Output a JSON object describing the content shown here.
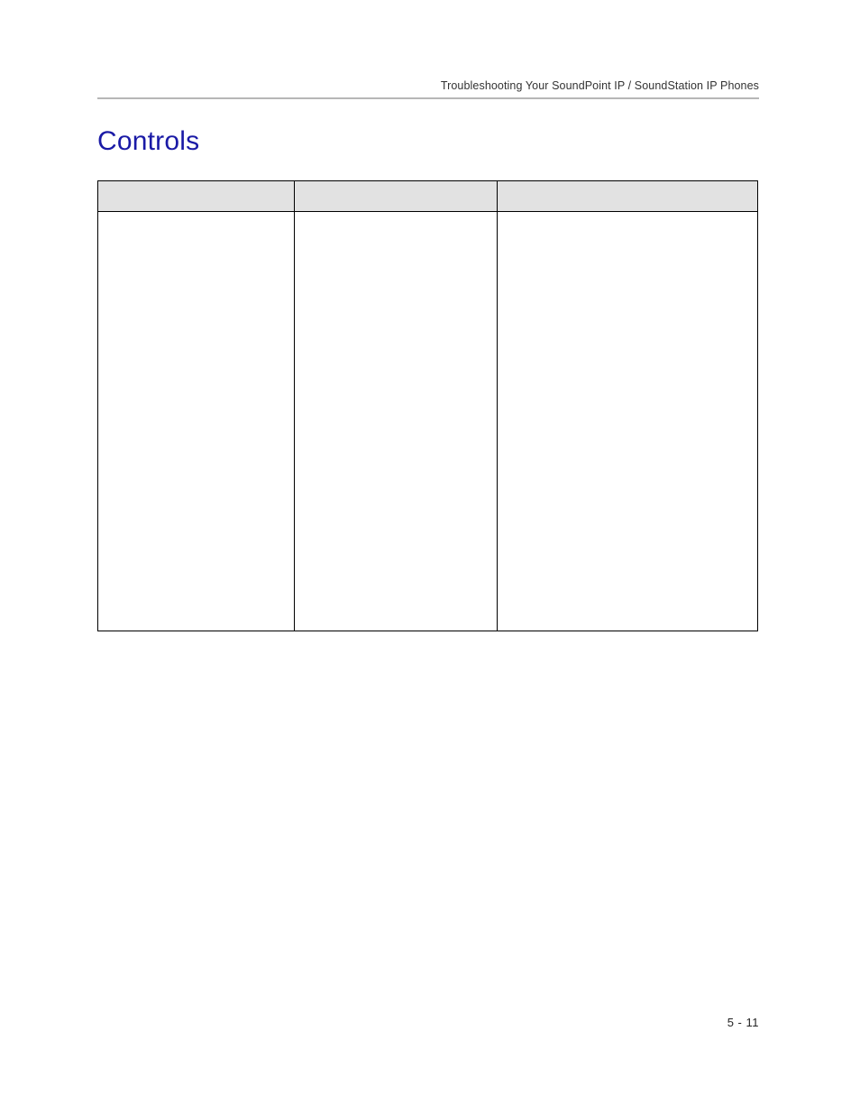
{
  "header": {
    "running_title": "Troubleshooting Your SoundPoint IP / SoundStation IP Phones"
  },
  "section": {
    "title": "Controls"
  },
  "table": {
    "headers": [
      "",
      "",
      ""
    ],
    "rows": [
      {
        "cells": [
          "",
          "",
          ""
        ]
      }
    ]
  },
  "footer": {
    "page_number": "5 - 11"
  }
}
